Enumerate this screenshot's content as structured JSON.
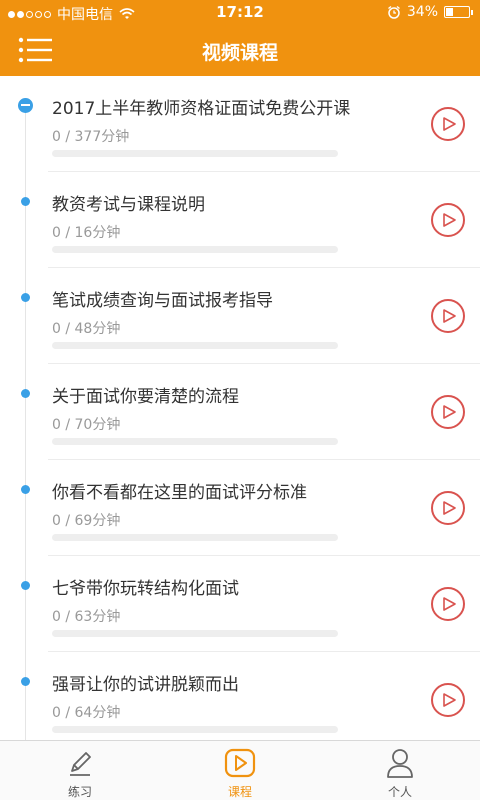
{
  "status_bar": {
    "carrier": "中国电信",
    "time": "17:12",
    "battery_percent": "34%",
    "battery_level": 0.34
  },
  "header": {
    "title": "视频课程",
    "menu_icon": "list-menu-icon"
  },
  "courses": [
    {
      "title": "2017上半年教师资格证面试免费公开课",
      "progress_text": "0 / 377分钟",
      "progress": 0,
      "current": true
    },
    {
      "title": "教资考试与课程说明",
      "progress_text": "0 / 16分钟",
      "progress": 0,
      "current": false
    },
    {
      "title": "笔试成绩查询与面试报考指导",
      "progress_text": "0 / 48分钟",
      "progress": 0,
      "current": false
    },
    {
      "title": "关于面试你要清楚的流程",
      "progress_text": "0 / 70分钟",
      "progress": 0,
      "current": false
    },
    {
      "title": "你看不看都在这里的面试评分标准",
      "progress_text": "0 / 69分钟",
      "progress": 0,
      "current": false
    },
    {
      "title": "七爷带你玩转结构化面试",
      "progress_text": "0 / 63分钟",
      "progress": 0,
      "current": false
    },
    {
      "title": "强哥让你的试讲脱颖而出",
      "progress_text": "0 / 64分钟",
      "progress": 0,
      "current": false
    }
  ],
  "tabbar": {
    "tabs": [
      {
        "label": "练习",
        "icon": "pencil-icon",
        "active": false
      },
      {
        "label": "课程",
        "icon": "play-icon",
        "active": true
      },
      {
        "label": "个人",
        "icon": "person-icon",
        "active": false
      }
    ]
  },
  "colors": {
    "accent": "#f0920f",
    "timeline_dot": "#3aa0e6",
    "play_button": "#d9534f"
  }
}
